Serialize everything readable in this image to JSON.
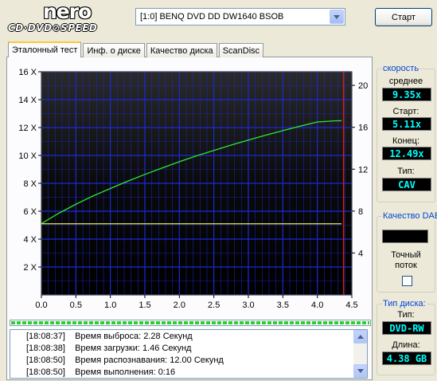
{
  "logo": {
    "brand": "nero",
    "product": "CD·DVD⊘SPEED"
  },
  "drive": {
    "selected": "[1:0]  BENQ DVD DD DW1640 BSOB"
  },
  "start_button": {
    "label": "Старт"
  },
  "tabs": [
    {
      "label": "Эталонный тест",
      "active": true
    },
    {
      "label": "Инф. о диске",
      "active": false
    },
    {
      "label": "Качество диска",
      "active": false
    },
    {
      "label": "ScanDisc",
      "active": false
    }
  ],
  "chart_data": {
    "type": "line",
    "x_ticks": [
      "0.0",
      "0.5",
      "1.0",
      "1.5",
      "2.0",
      "2.5",
      "3.0",
      "3.5",
      "4.0",
      "4.5"
    ],
    "y_left_ticks": [
      "2 X",
      "4 X",
      "6 X",
      "8 X",
      "10 X",
      "12 X",
      "14 X",
      "16 X"
    ],
    "y_right_ticks": [
      "4",
      "8",
      "12",
      "16",
      "20"
    ],
    "xlim": [
      0,
      4.5
    ],
    "ylim_left": [
      0,
      16
    ],
    "ylim_right": [
      0,
      21.3
    ],
    "grid": true,
    "series": [
      {
        "color": "#2ee82e",
        "x": [
          0,
          0.25,
          0.5,
          0.75,
          1.0,
          1.25,
          1.5,
          1.75,
          2.0,
          2.25,
          2.5,
          2.75,
          3.0,
          3.25,
          3.5,
          3.75,
          4.0,
          4.25,
          4.35
        ],
        "y": [
          5.11,
          5.85,
          6.5,
          7.1,
          7.63,
          8.15,
          8.64,
          9.1,
          9.55,
          9.97,
          10.36,
          10.74,
          11.1,
          11.45,
          11.78,
          12.1,
          12.4,
          12.48,
          12.49
        ]
      },
      {
        "color": "#f0f050",
        "x": [
          0,
          0.5,
          1.0,
          1.5,
          2.0,
          2.5,
          3.0,
          3.5,
          4.0,
          4.35
        ],
        "y": [
          6.8,
          6.8,
          6.8,
          6.8,
          6.8,
          6.8,
          6.8,
          6.8,
          6.8,
          6.8
        ]
      }
    ],
    "marker_x": 4.38,
    "marker_color": "#cc2222",
    "background": "#000000",
    "grid_color": "#1a2bd8"
  },
  "progress": {
    "percent": 100,
    "color": "#2bd12b"
  },
  "log": [
    {
      "time": "[18:08:37]",
      "text": "Время выброса: 2.28 Секунд"
    },
    {
      "time": "[18:08:38]",
      "text": "Время загрузки: 1.46 Секунд"
    },
    {
      "time": "[18:08:50]",
      "text": "Время распознавания: 12.00 Секунд"
    },
    {
      "time": "[18:08:50]",
      "text": "Время выполнения:  0:16"
    }
  ],
  "speed": {
    "title": "скорость",
    "avg_label": "среднее",
    "avg_value": "9.35x",
    "start_label": "Старт:",
    "start_value": "5.11x",
    "end_label": "Конец:",
    "end_value": "12.49x",
    "type_label": "Тип:",
    "type_value": "CAV",
    "value_color": "#00ffff"
  },
  "dae": {
    "title": "Качество DAE",
    "exact_stream_line1": "Точный",
    "exact_stream_line2": "поток",
    "checked": false
  },
  "disc": {
    "title": "Тип диска:",
    "type_label": "Тип:",
    "type_value": "DVD-RW",
    "length_label": "Длина:",
    "length_value": "4.38 GB"
  }
}
